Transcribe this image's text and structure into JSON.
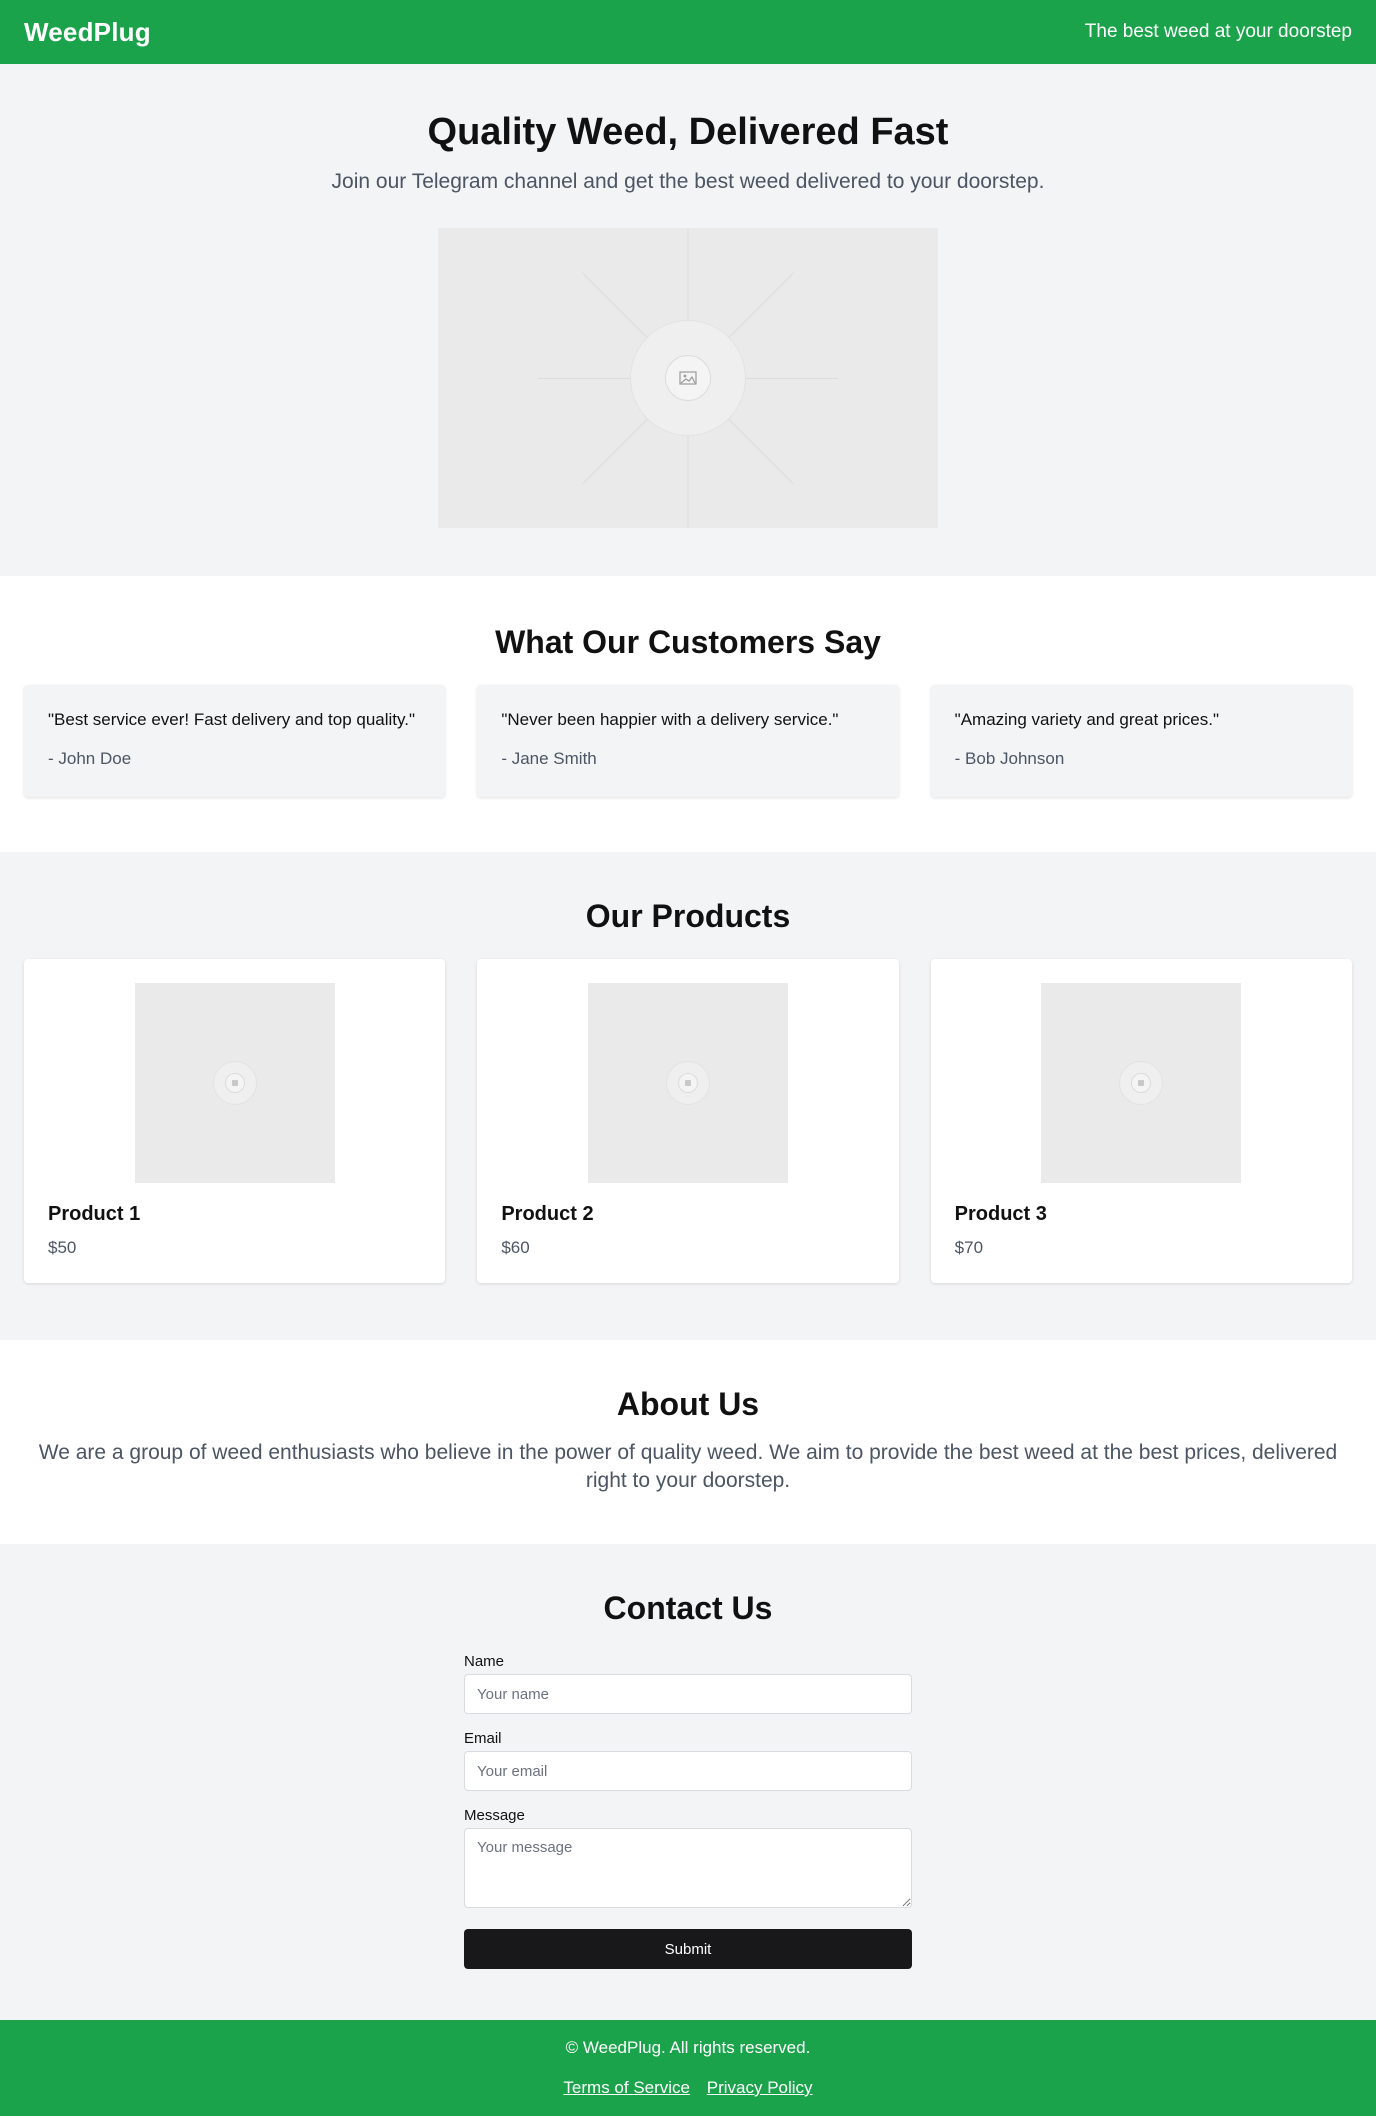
{
  "header": {
    "logo": "WeedPlug",
    "tagline": "The best weed at your doorstep"
  },
  "hero": {
    "title": "Quality Weed, Delivered Fast",
    "subtitle": "Join our Telegram channel and get the best weed delivered to your doorstep."
  },
  "testimonials": {
    "title": "What Our Customers Say",
    "items": [
      {
        "quote": "\"Best service ever! Fast delivery and top quality.\"",
        "author": "- John Doe"
      },
      {
        "quote": "\"Never been happier with a delivery service.\"",
        "author": "- Jane Smith"
      },
      {
        "quote": "\"Amazing variety and great prices.\"",
        "author": "- Bob Johnson"
      }
    ]
  },
  "products": {
    "title": "Our Products",
    "items": [
      {
        "name": "Product 1",
        "price": "$50"
      },
      {
        "name": "Product 2",
        "price": "$60"
      },
      {
        "name": "Product 3",
        "price": "$70"
      }
    ]
  },
  "about": {
    "title": "About Us",
    "text": "We are a group of weed enthusiasts who believe in the power of quality weed. We aim to provide the best weed at the best prices, delivered right to your doorstep."
  },
  "contact": {
    "title": "Contact Us",
    "name_label": "Name",
    "name_placeholder": "Your name",
    "email_label": "Email",
    "email_placeholder": "Your email",
    "message_label": "Message",
    "message_placeholder": "Your message",
    "submit_label": "Submit"
  },
  "footer": {
    "copyright": "© WeedPlug. All rights reserved.",
    "links": [
      "Terms of Service",
      "Privacy Policy"
    ]
  },
  "colors": {
    "brand_green": "#1aa34a",
    "section_gray": "#f3f4f6",
    "button_dark": "#18181b"
  },
  "icons": {
    "placeholder": "image-placeholder-icon"
  }
}
